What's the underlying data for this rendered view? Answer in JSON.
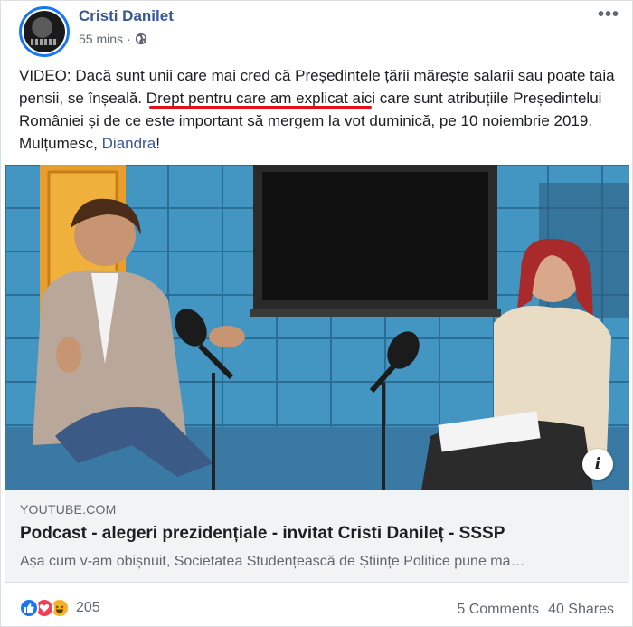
{
  "post": {
    "author": "Cristi Danilet",
    "timestamp": "55 mins",
    "separator": "·",
    "privacy_icon": "globe-icon",
    "more_icon": "more-icon",
    "text_main": "VIDEO: Dacă sunt unii care mai cred că Președintele țării mărește salarii sau poate taia pensii, se înșeală. Drept pentru care am explicat aici care sunt atribuțiile Președintelui României și de ce este important să mergem la vot duminică, pe 10 noiembrie 2019. Mulțumesc, ",
    "mention": "Diandra",
    "text_end": "!"
  },
  "media": {
    "info_label": "i"
  },
  "link": {
    "domain": "YOUTUBE.COM",
    "title": "Podcast - alegeri prezidențiale - invitat Cristi Danileț - SSSP",
    "description": "Așa cum v-am obișnuit, Societatea Studențească de Științe Politice pune ma…"
  },
  "footer": {
    "reaction_count": "205",
    "comments": "5 Comments",
    "shares": "40 Shares"
  },
  "colors": {
    "link_blue": "#365899",
    "underline_red": "#e0111b",
    "meta_gray": "#606770"
  }
}
